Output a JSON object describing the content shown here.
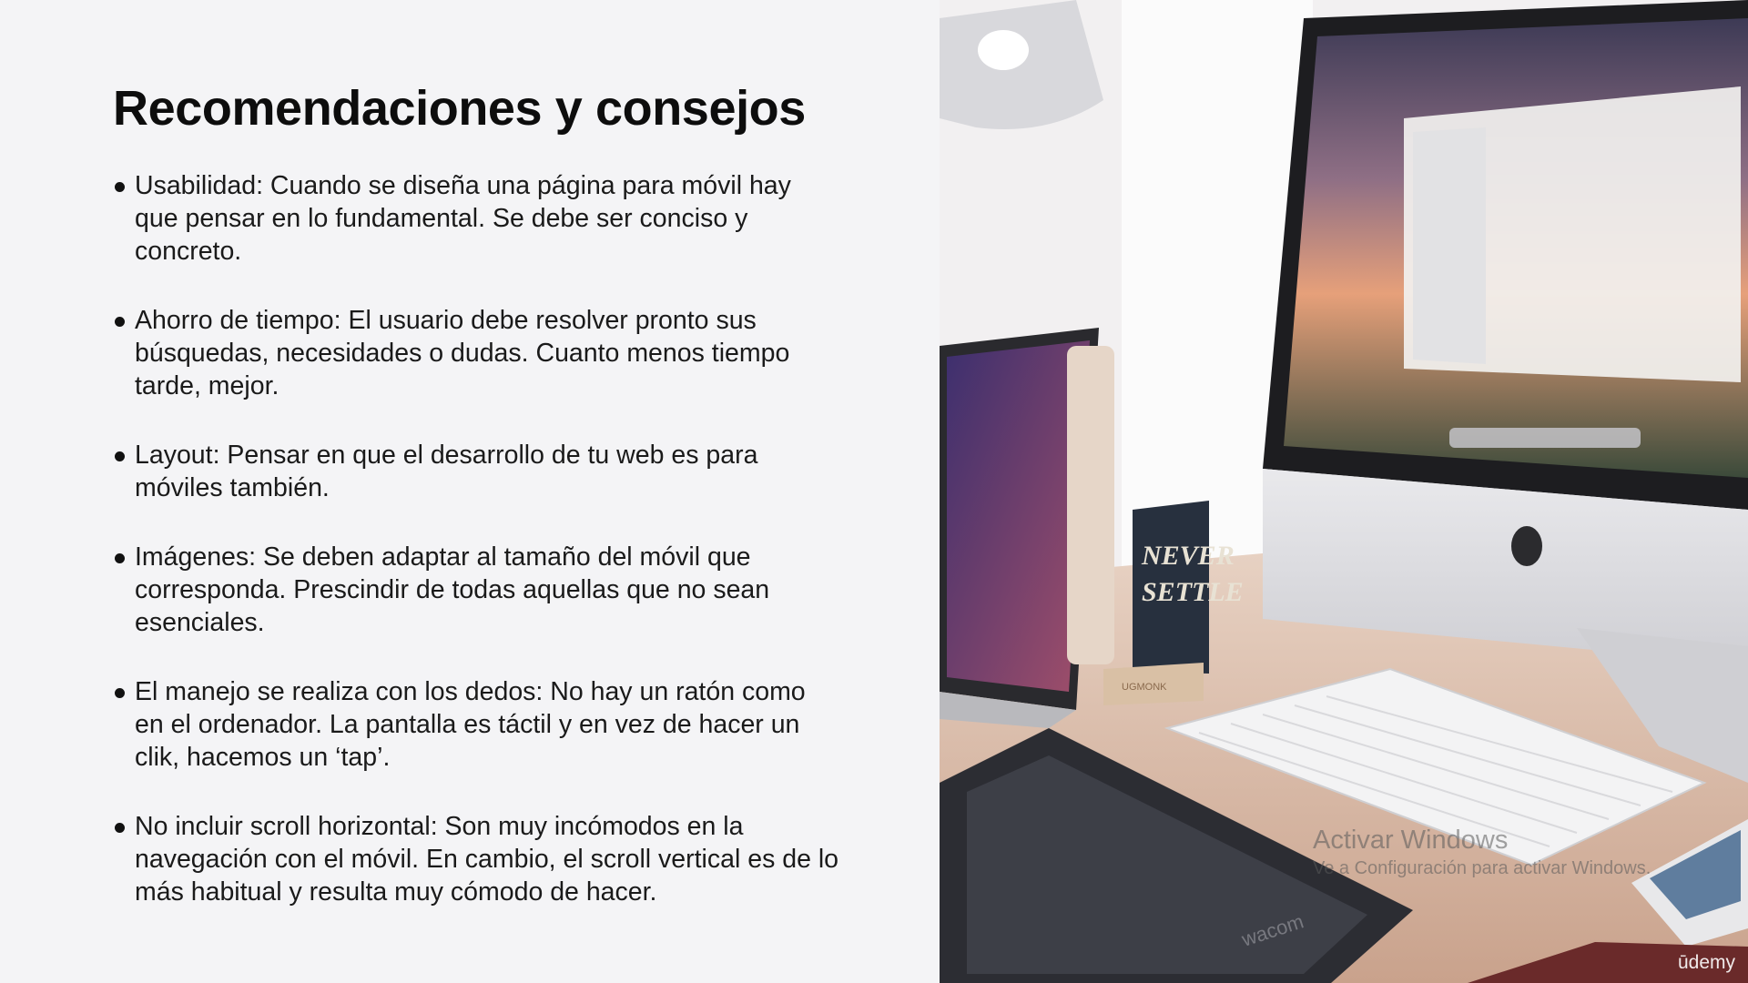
{
  "slide": {
    "title": "Recomendaciones y consejos",
    "bullets": [
      "Usabilidad: Cuando se diseña una página para móvil hay que pensar en lo fundamental. Se debe ser conciso y concreto.",
      "Ahorro de tiempo: El usuario debe resolver pronto sus búsquedas, necesidades o dudas. Cuanto menos tiempo tarde, mejor.",
      "Layout: Pensar en que el desarrollo de tu web es para móviles también.",
      "Imágenes: Se deben adaptar al tamaño del móvil que corresponda. Prescindir de todas aquellas que no sean esenciales.",
      "El manejo se realiza con los dedos: No hay un ratón como en el ordenador. La pantalla es táctil y en vez de hacer un clik, hacemos un ‘tap’.",
      "No incluir scroll horizontal: Son muy incómodos en la navegación con el móvil. En cambio, el scroll vertical es de lo más habitual y resulta muy cómodo de hacer."
    ]
  },
  "photo": {
    "card_text_line1": "NEVER",
    "card_text_line2": "SETTLE",
    "tablet_brand": "wacom",
    "block_text": "UGMONK"
  },
  "watermark": {
    "title": "Activar Windows",
    "subtitle": "Ve a Configuración para activar Windows."
  },
  "brand": "ūdemy",
  "colors": {
    "background": "#f4f4f6",
    "text": "#1a1a1a",
    "title": "#0d0d0d"
  }
}
